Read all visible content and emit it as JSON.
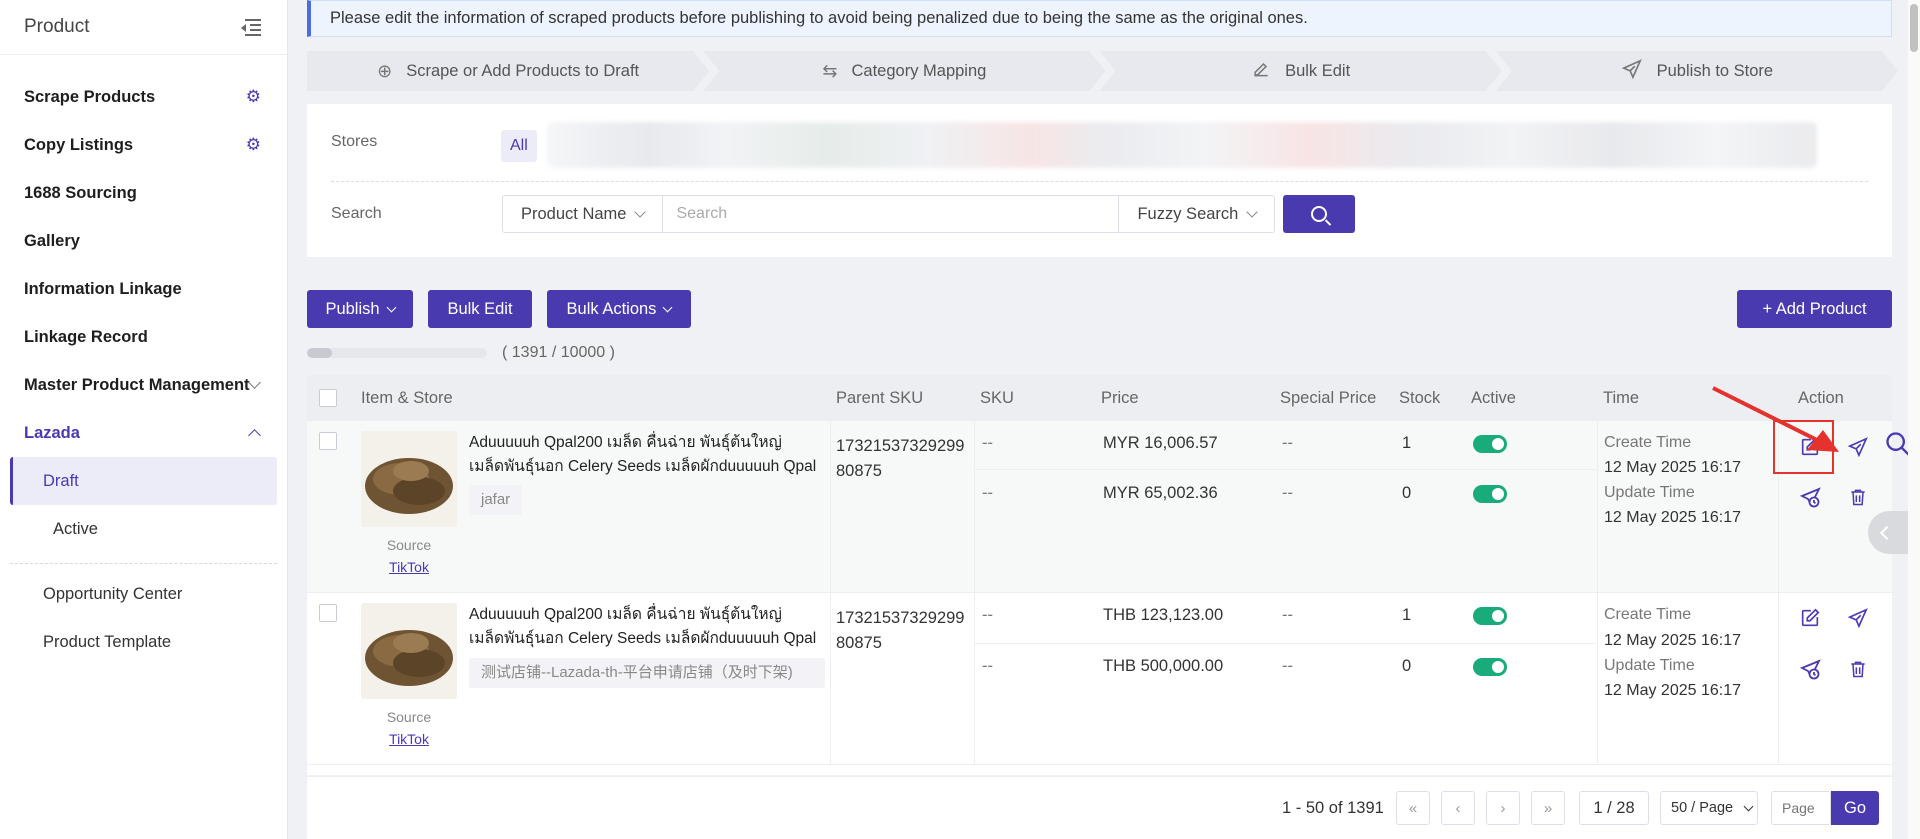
{
  "sidebar": {
    "title": "Product",
    "items": [
      {
        "label": "Scrape Products",
        "icon": "gear-icon"
      },
      {
        "label": "Copy Listings",
        "icon": "gear-icon"
      },
      {
        "label": "1688 Sourcing"
      },
      {
        "label": "Gallery"
      },
      {
        "label": "Information Linkage"
      },
      {
        "label": "Linkage Record"
      },
      {
        "label": "Master Product Management"
      },
      {
        "label": "Lazada"
      }
    ],
    "sub_items": [
      {
        "label": "Draft",
        "selected": true
      },
      {
        "label": "Active"
      }
    ],
    "bottom_items": [
      {
        "label": "Opportunity Center"
      },
      {
        "label": "Product Template"
      }
    ]
  },
  "notice": "Please edit the information of scraped products before publishing to avoid being penalized due to being the same as the original ones.",
  "steps": [
    {
      "label": "Scrape or Add Products to Draft",
      "icon": "plus-circle-icon"
    },
    {
      "label": "Category Mapping",
      "icon": "swap-icon"
    },
    {
      "label": "Bulk Edit",
      "icon": "edit-icon"
    },
    {
      "label": "Publish to Store",
      "icon": "send-icon"
    }
  ],
  "filter": {
    "stores_label": "Stores",
    "stores_all": "All",
    "search_label": "Search",
    "field_select": "Product Name",
    "search_placeholder": "Search",
    "mode_select": "Fuzzy Search"
  },
  "toolbar": {
    "publish": "Publish",
    "bulk_edit": "Bulk Edit",
    "bulk_actions": "Bulk Actions",
    "add_product": "+ Add Product"
  },
  "quota": {
    "text": "( 1391 / 10000 )",
    "used": 1391,
    "total": 10000
  },
  "table": {
    "columns": [
      "Item & Store",
      "Parent SKU",
      "SKU",
      "Price",
      "Special Price",
      "Stock",
      "Active",
      "Time",
      "Action"
    ],
    "source_label": "Source",
    "create_label": "Create Time",
    "update_label": "Update Time",
    "rows": [
      {
        "name": "Aduuuuuh Qpal200 เมล็ด คื่นฉ่าย พันธุ์ต้นใหญ่ เมล็ดพันธุ์นอก Celery Seeds เมล็ดผักduuuuuh Qpal",
        "store": "jafar",
        "source": "TikTok",
        "parent_sku": "1732153732929980875",
        "variants": [
          {
            "sku": "--",
            "price": "MYR 16,006.57",
            "special": "--",
            "stock": "1",
            "active": true
          },
          {
            "sku": "--",
            "price": "MYR 65,002.36",
            "special": "--",
            "stock": "0",
            "active": true
          }
        ],
        "create_time": "12 May 2025 16:17",
        "update_time": "12 May 2025 16:17"
      },
      {
        "name": "Aduuuuuh Qpal200 เมล็ด คื่นฉ่าย พันธุ์ต้นใหญ่ เมล็ดพันธุ์นอก Celery Seeds เมล็ดผักduuuuuh Qpal",
        "store": "测试店铺--Lazada-th-平台申请店铺（及时下架)",
        "source": "TikTok",
        "parent_sku": "1732153732929980875",
        "variants": [
          {
            "sku": "--",
            "price": "THB 123,123.00",
            "special": "--",
            "stock": "1",
            "active": true
          },
          {
            "sku": "--",
            "price": "THB 500,000.00",
            "special": "--",
            "stock": "0",
            "active": true
          }
        ],
        "create_time": "12 May 2025 16:17",
        "update_time": "12 May 2025 16:17"
      }
    ]
  },
  "pager": {
    "info": "1 - 50 of 1391",
    "current": "1 / 28",
    "page_size": "50 / Page",
    "page_placeholder": "Page",
    "go": "Go"
  },
  "colors": {
    "accent": "#4a3ab0",
    "toggle_on": "#1aab7b",
    "highlight": "#e5322d"
  }
}
